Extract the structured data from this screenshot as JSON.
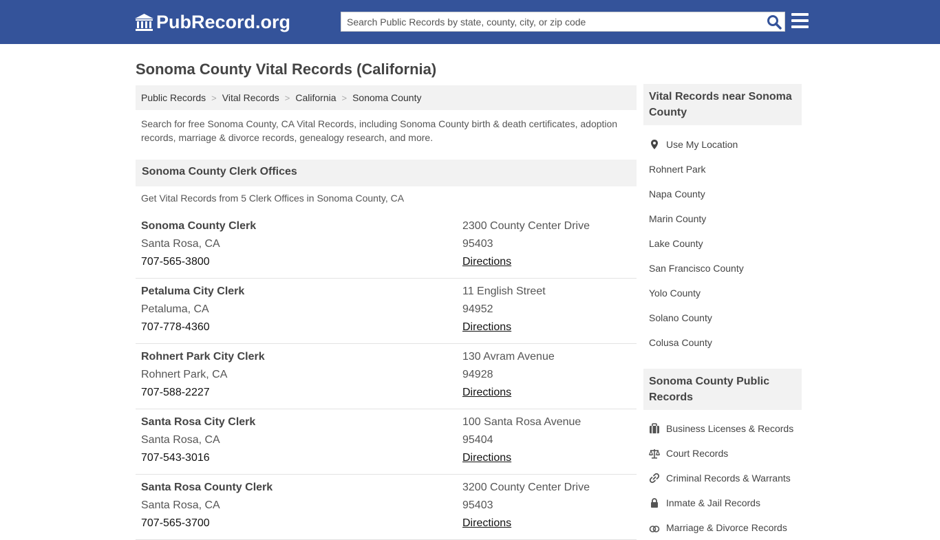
{
  "header": {
    "logo_text": "PubRecord.org",
    "search_placeholder": "Search Public Records by state, county, city, or zip code"
  },
  "page_title": "Sonoma County Vital Records (California)",
  "breadcrumb": [
    {
      "label": "Public Records"
    },
    {
      "label": "Vital Records"
    },
    {
      "label": "California"
    },
    {
      "label": "Sonoma County"
    }
  ],
  "intro": "Search for free Sonoma County, CA Vital Records, including Sonoma County birth & death certificates, adoption records, marriage & divorce records, genealogy research, and more.",
  "clerk_section": {
    "title": "Sonoma County Clerk Offices",
    "subtext": "Get Vital Records from 5 Clerk Offices in Sonoma County, CA",
    "directions_label": "Directions",
    "offices": [
      {
        "name": "Sonoma County Clerk",
        "city": "Santa Rosa, CA",
        "phone": "707-565-3800",
        "address": "2300 County Center Drive",
        "zip": "95403"
      },
      {
        "name": "Petaluma City Clerk",
        "city": "Petaluma, CA",
        "phone": "707-778-4360",
        "address": "11 English Street",
        "zip": "94952"
      },
      {
        "name": "Rohnert Park City Clerk",
        "city": "Rohnert Park, CA",
        "phone": "707-588-2227",
        "address": "130 Avram Avenue",
        "zip": "94928"
      },
      {
        "name": "Santa Rosa City Clerk",
        "city": "Santa Rosa, CA",
        "phone": "707-543-3016",
        "address": "100 Santa Rosa Avenue",
        "zip": "95404"
      },
      {
        "name": "Santa Rosa County Clerk",
        "city": "Santa Rosa, CA",
        "phone": "707-565-3700",
        "address": "3200 County Center Drive",
        "zip": "95403"
      }
    ]
  },
  "sidebar": {
    "nearby_title": "Vital Records near Sonoma County",
    "use_location": "Use My Location",
    "nearby": [
      "Rohnert Park",
      "Napa County",
      "Marin County",
      "Lake County",
      "San Francisco County",
      "Yolo County",
      "Solano County",
      "Colusa County"
    ],
    "public_title": "Sonoma County Public Records",
    "public_records": [
      {
        "label": "Business Licenses & Records",
        "icon": "briefcase-icon"
      },
      {
        "label": "Court Records",
        "icon": "scales-icon"
      },
      {
        "label": "Criminal Records & Warrants",
        "icon": "link-icon"
      },
      {
        "label": "Inmate & Jail Records",
        "icon": "lock-icon"
      },
      {
        "label": "Marriage & Divorce Records",
        "icon": "rings-icon"
      }
    ]
  },
  "colors": {
    "header_bg": "#34539a",
    "panel_bg": "#f2f2f2"
  }
}
